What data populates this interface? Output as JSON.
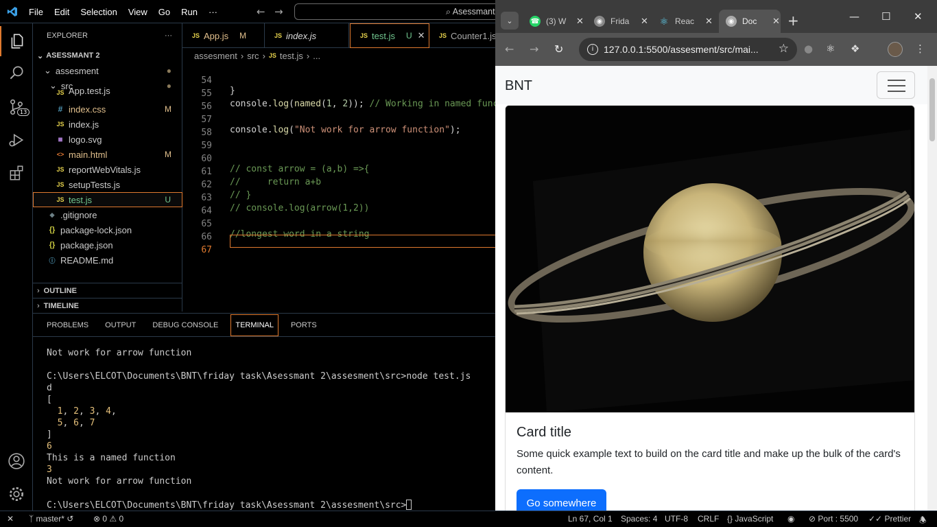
{
  "vscode": {
    "menu": [
      "File",
      "Edit",
      "Selection",
      "View",
      "Go",
      "Run",
      "···"
    ],
    "command_center": "⌕ Asessmant",
    "activity": {
      "scm_badge": "13"
    },
    "explorer": {
      "title": "EXPLORER",
      "more": "···",
      "root": "ASESSMANT 2",
      "folder1": "assesment",
      "folder2": "src",
      "files": [
        {
          "name": "App.test.js",
          "icon": "JS",
          "status": ""
        },
        {
          "name": "index.css",
          "icon": "#",
          "status": "M"
        },
        {
          "name": "index.js",
          "icon": "JS",
          "status": ""
        },
        {
          "name": "logo.svg",
          "icon": "■",
          "status": ""
        },
        {
          "name": "main.html",
          "icon": "<>",
          "status": "M"
        },
        {
          "name": "reportWebVitals.js",
          "icon": "JS",
          "status": ""
        },
        {
          "name": "setupTests.js",
          "icon": "JS",
          "status": ""
        },
        {
          "name": "test.js",
          "icon": "JS",
          "status": "U"
        },
        {
          "name": ".gitignore",
          "icon": "◆",
          "status": ""
        },
        {
          "name": "package-lock.json",
          "icon": "{}",
          "status": ""
        },
        {
          "name": "package.json",
          "icon": "{}",
          "status": ""
        },
        {
          "name": "README.md",
          "icon": "ⓘ",
          "status": ""
        }
      ],
      "outline": "OUTLINE",
      "timeline": "TIMELINE"
    },
    "tabs": [
      {
        "name": "App.js",
        "status": "M"
      },
      {
        "name": "index.js",
        "status": ""
      },
      {
        "name": "test.js",
        "status": "U"
      },
      {
        "name": "Counter1.js",
        "status": ""
      }
    ],
    "tab_close": "✕",
    "breadcrumb": [
      "assesment",
      "src",
      "test.js",
      "..."
    ],
    "lines": [
      "54",
      "55",
      "56",
      "57",
      "58",
      "59",
      "60",
      "61",
      "62",
      "63",
      "64",
      "65",
      "66",
      "67"
    ],
    "code": {
      "l54": "}",
      "l55a": "console.",
      "l55b": "log",
      "l55c": "(",
      "l55d": "named",
      "l55e": "(",
      "l55f": "1",
      "l55g": ", ",
      "l55h": "2",
      "l55i": ")); ",
      "l55j": "// Working in named function",
      "l57a": "console.",
      "l57b": "log",
      "l57c": "(",
      "l57d": "\"Not work for arrow function\"",
      "l57e": ");",
      "l60": "// const arrow = (a,b) =>{",
      "l61": "//     return a+b",
      "l62": "// }",
      "l63": "// console.log(arrow(1,2))",
      "l65": "//longest word in a string"
    },
    "panel_tabs": [
      "PROBLEMS",
      "OUTPUT",
      "DEBUG CONSOLE",
      "TERMINAL",
      "PORTS"
    ],
    "terminal": {
      "l1": "Not work for arrow function",
      "l2": "C:\\Users\\ELCOT\\Documents\\BNT\\friday task\\Asessmant 2\\assesment\\src>node test.js",
      "l3": "d",
      "l4": "[",
      "l5a": "  ",
      "l5n1": "1",
      "l5s1": ", ",
      "l5n2": "2",
      "l5s2": ", ",
      "l5n3": "3",
      "l5s3": ", ",
      "l5n4": "4",
      "l5s4": ",",
      "l6a": "  ",
      "l6n1": "5",
      "l6s1": ", ",
      "l6n2": "6",
      "l6s2": ", ",
      "l6n3": "7",
      "l7": "]",
      "l8": "6",
      "l9": "This is a named function",
      "l10": "3",
      "l11": "Not work for arrow function",
      "l12": "C:\\Users\\ELCOT\\Documents\\BNT\\friday task\\Asessmant 2\\assesment\\src>"
    },
    "status": {
      "close": "✕",
      "branch": "master*",
      "problems": "⊗ 0 ⚠ 0",
      "position": "Ln 67, Col 1",
      "spaces": "Spaces: 4",
      "encoding": "UTF-8",
      "eol": "CRLF",
      "language": "JavaScript",
      "port": "Port : 5500",
      "prettier": "Prettier"
    }
  },
  "chrome": {
    "tabs": [
      {
        "label": "(3) W",
        "favicon": "whatsapp-icon"
      },
      {
        "label": "Frida",
        "favicon": "globe-icon"
      },
      {
        "label": "Reac",
        "favicon": "react-icon"
      },
      {
        "label": "Doc",
        "favicon": "globe-icon"
      }
    ],
    "tab_close": "✕",
    "new_tab": "+",
    "minimize": "—",
    "maximize": "☐",
    "close": "✕",
    "url": "127.0.0.1:5500/assesment/src/mai...",
    "page": {
      "brand": "BNT",
      "card_title": "Card title",
      "card_text": "Some quick example text to build on the card title and make up the bulk of the card's content.",
      "button": "Go somewhere"
    }
  },
  "colors": {
    "accent_orange": "#e07a2f",
    "bootstrap_primary": "#0d6efd",
    "js_yellow": "#e8d44d",
    "git_modified": "#e2c08d",
    "git_untracked": "#73c991"
  }
}
